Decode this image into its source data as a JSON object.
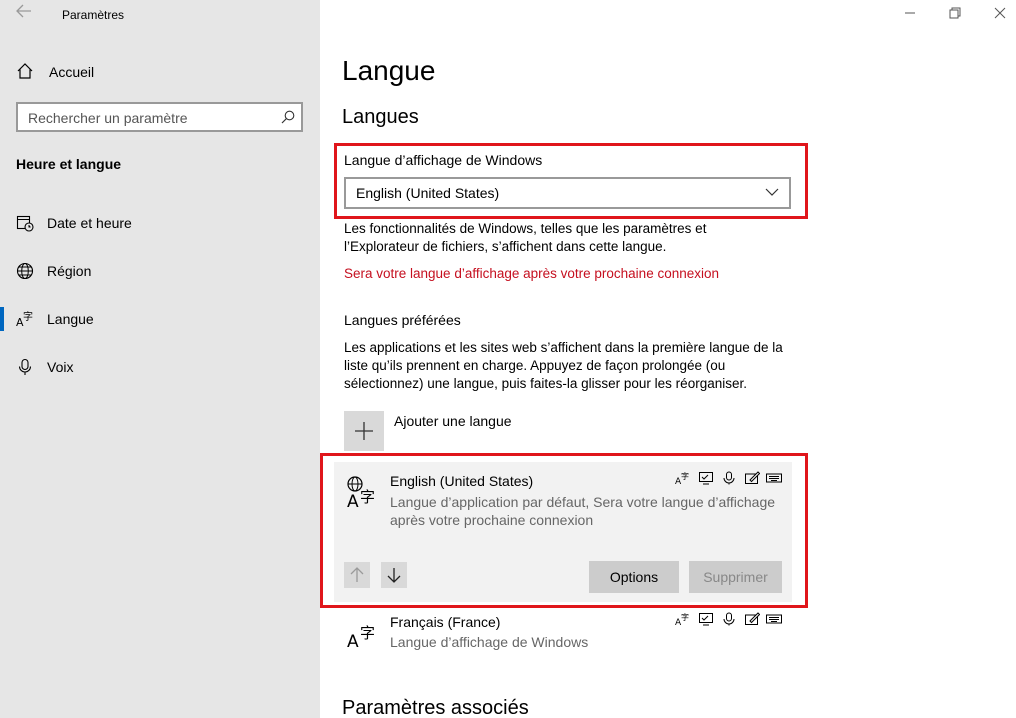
{
  "window": {
    "app_title": "Paramètres",
    "back_icon": "back-arrow-icon",
    "controls": [
      "minimize-icon",
      "restore-icon",
      "close-icon"
    ]
  },
  "sidebar": {
    "home_label": "Accueil",
    "search_placeholder": "Rechercher un paramètre",
    "section_title": "Heure et langue",
    "items": [
      {
        "label": "Date et heure",
        "icon": "date-time-icon"
      },
      {
        "label": "Région",
        "icon": "globe-icon"
      },
      {
        "label": "Langue",
        "icon": "language-icon",
        "active": true
      },
      {
        "label": "Voix",
        "icon": "microphone-icon"
      }
    ]
  },
  "main": {
    "title": "Langue",
    "languages_heading": "Langues",
    "display_language_label": "Langue d’affichage de Windows",
    "display_language_value": "English (United States)",
    "display_language_desc_1": "Les fonctionnalités de Windows, telles que les paramètres et",
    "display_language_desc_2": "l’Explorateur de fichiers, s’affichent dans cette langue.",
    "warning": "Sera votre langue d’affichage après votre prochaine connexion",
    "preferred_heading": "Langues préférées",
    "preferred_desc_1": "Les applications et les sites web s’affichent dans la première langue de la",
    "preferred_desc_2": "liste qu’ils prennent en charge. Appuyez de façon prolongée (ou",
    "preferred_desc_3": "sélectionnez) une langue, puis faites-la glisser pour les réorganiser.",
    "add_language": "Ajouter une langue",
    "languages": [
      {
        "name": "English (United States)",
        "desc_1": "Langue d’application par défaut, Sera votre langue d’affichage",
        "desc_2": "après votre prochaine connexion",
        "options_label": "Options",
        "remove_label": "Supprimer"
      },
      {
        "name": "Français (France)",
        "desc_1": "Langue d’affichage de Windows"
      }
    ],
    "related_heading": "Paramètres associés"
  },
  "colors": {
    "accent": "#0067c0",
    "highlight_border": "#e0161b",
    "warning_text": "#c50f1f"
  }
}
